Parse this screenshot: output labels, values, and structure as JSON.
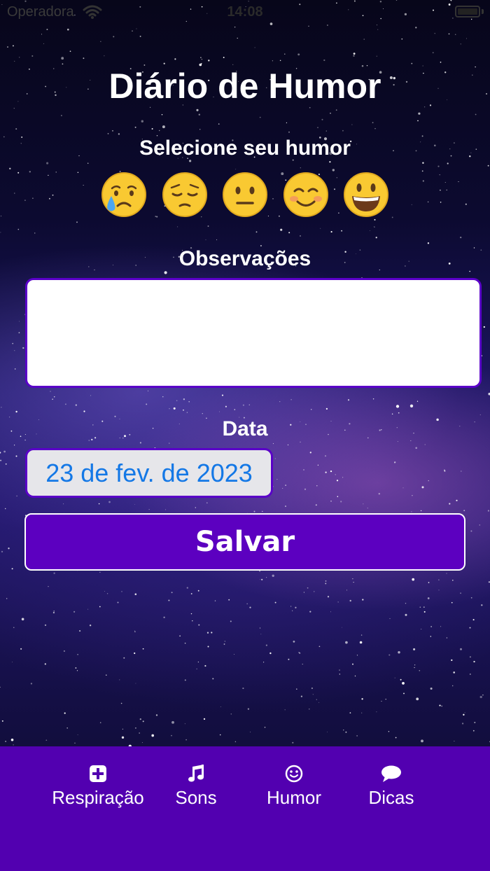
{
  "status_bar": {
    "carrier": "Operadora",
    "time": "14:08"
  },
  "title": "Diário de Humor",
  "mood_section": {
    "label": "Selecione seu humor",
    "moods": [
      "crying-face",
      "pensive-face",
      "neutral-face",
      "smiling-face",
      "grinning-face"
    ]
  },
  "notes": {
    "label": "Observações",
    "value": ""
  },
  "date": {
    "label": "Data",
    "value": "23 de fev. de 2023"
  },
  "save_label": "Salvar",
  "tabs": [
    {
      "label": "Respiração",
      "icon": "plus-square-icon"
    },
    {
      "label": "Sons",
      "icon": "music-note-icon"
    },
    {
      "label": "Humor",
      "icon": "smiley-icon"
    },
    {
      "label": "Dicas",
      "icon": "chat-bubble-icon"
    }
  ],
  "colors": {
    "accent": "#5c00c0",
    "tab_bar": "#5200b0",
    "date_text": "#1478e6"
  }
}
